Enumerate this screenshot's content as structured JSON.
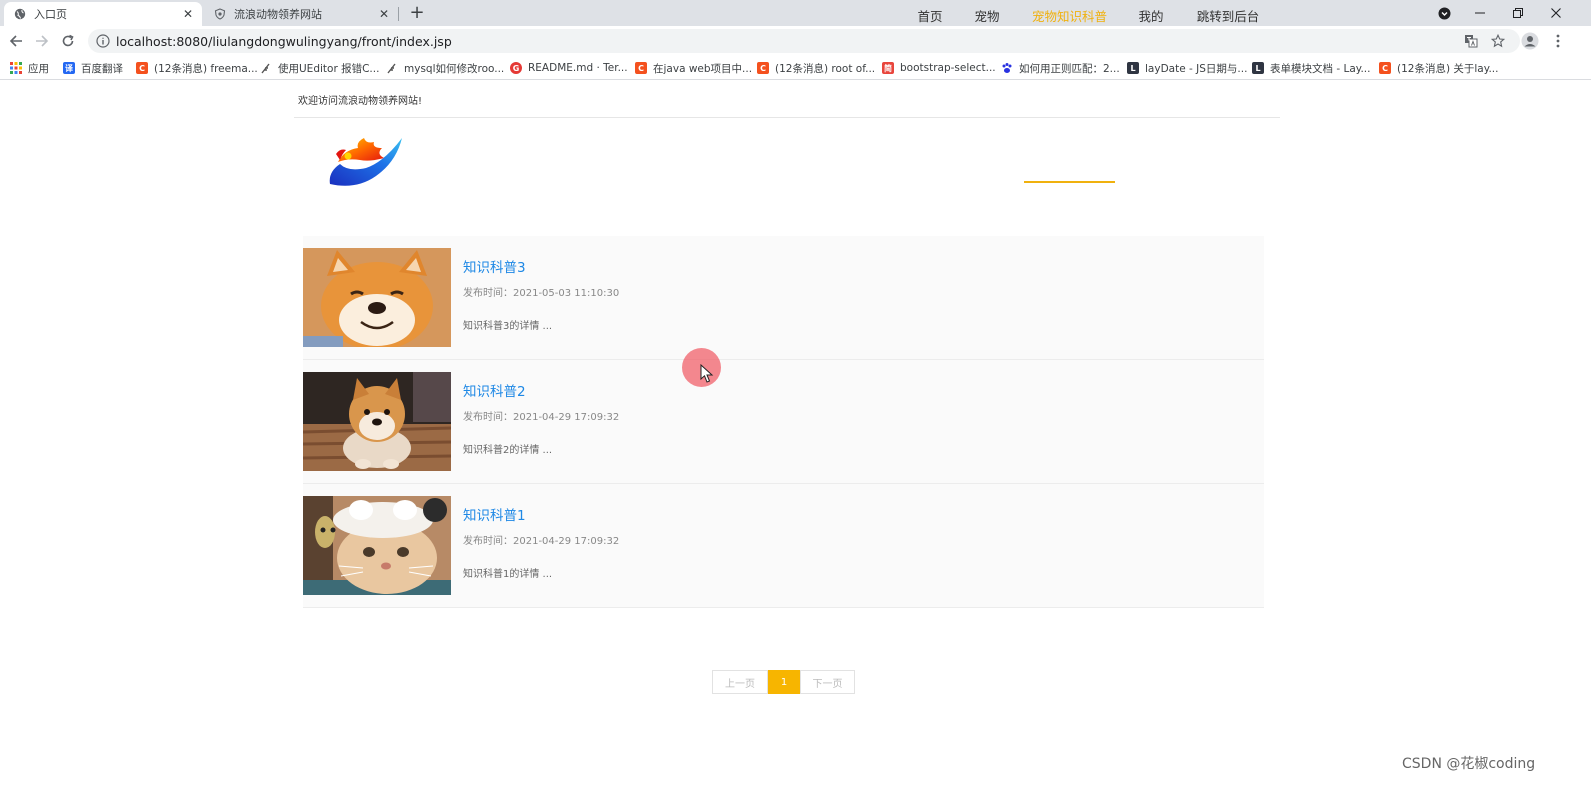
{
  "browser": {
    "tabs": [
      {
        "label": "入口页",
        "active": true
      },
      {
        "label": "流浪动物领养网站",
        "active": false
      }
    ],
    "url": "localhost:8080/liulangdongwulingyang/front/index.jsp",
    "bookmarks": [
      {
        "label": "应用",
        "color": "#4285f4"
      },
      {
        "label": "百度翻译",
        "color": "#2468f2",
        "glyph": "译"
      },
      {
        "label": "(12条消息) freema...",
        "color": "#f4511e",
        "glyph": "C"
      },
      {
        "label": "使用UEditor 报错C...",
        "color": "#555555",
        "glyph": ""
      },
      {
        "label": "mysql如何修改roo...",
        "color": "#555555",
        "glyph": ""
      },
      {
        "label": "README.md · Ter...",
        "color": "#e53935",
        "glyph": "G"
      },
      {
        "label": "在java web项目中...",
        "color": "#f4511e",
        "glyph": "C"
      },
      {
        "label": "(12条消息) root of...",
        "color": "#f4511e",
        "glyph": "C"
      },
      {
        "label": "bootstrap-select...",
        "color": "#e8453c",
        "glyph": "简"
      },
      {
        "label": "如何用正则匹配：2...",
        "color": "#2932e1",
        "glyph": ""
      },
      {
        "label": "layDate - JS日期与...",
        "color": "#2f3542",
        "glyph": "L"
      },
      {
        "label": "表单模块文档 - Lay...",
        "color": "#2f3542",
        "glyph": "L"
      },
      {
        "label": "(12条消息) 关于lay...",
        "color": "#f4511e",
        "glyph": "C"
      }
    ]
  },
  "site": {
    "welcome": "欢迎访问流浪动物领养网站!",
    "nav": [
      {
        "label": "首页",
        "active": false
      },
      {
        "label": "宠物",
        "active": false
      },
      {
        "label": "宠物知识科普",
        "active": true
      },
      {
        "label": "我的",
        "active": false
      },
      {
        "label": "跳转到后台",
        "active": false
      }
    ],
    "accent": "#f0b10e",
    "articles": [
      {
        "title": "知识科普3",
        "time": "发布时间：2021-05-03 11:10:30",
        "summary": "知识科普3的详情 ...",
        "image": "shiba-smile"
      },
      {
        "title": "知识科普2",
        "time": "发布时间：2021-04-29 17:09:32",
        "summary": "知识科普2的详情 ...",
        "image": "shiba-sitting"
      },
      {
        "title": "知识科普1",
        "time": "发布时间：2021-04-29 17:09:32",
        "summary": "知识科普1的详情 ...",
        "image": "cat-hat"
      }
    ],
    "pagination": {
      "prev": "上一页",
      "current": "1",
      "next": "下一页"
    }
  },
  "watermark": "CSDN @花椒coding"
}
